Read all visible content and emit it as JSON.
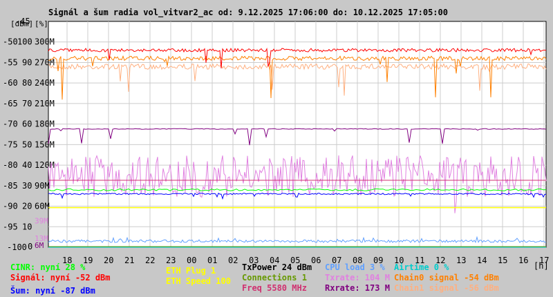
{
  "chart_data": {
    "type": "line",
    "title": "Signál a šum radia vol_vitvar2_ac od: 9.12.2025 17:06:00 do: 10.12.2025 17:05:00",
    "y_units": [
      "[dBm]",
      "[%]"
    ],
    "xlabel": "[h]",
    "x_ticks": [
      "18",
      "19",
      "20",
      "21",
      "22",
      "23",
      "00",
      "01",
      "02",
      "03",
      "04",
      "05",
      "06",
      "07",
      "08",
      "09",
      "10",
      "11",
      "12",
      "13",
      "14",
      "15",
      "16",
      "17"
    ],
    "y_ticks_dbm": [
      "-45",
      "-50",
      "-55",
      "-60",
      "-65",
      "-70",
      "-75",
      "-80",
      "-85",
      "-90",
      "-95",
      "-100"
    ],
    "y_ticks_pct": [
      "100",
      "90",
      "80",
      "70",
      "60",
      "50",
      "40",
      "30",
      "20",
      "10",
      "0"
    ],
    "y_ticks_rate": [
      "300M",
      "270M",
      "240M",
      "210M",
      "180M",
      "150M",
      "120M",
      "90M",
      "60M"
    ],
    "y_extra_labels": [
      {
        "text": "39M",
        "color": "#e080e0"
      },
      {
        "text": "13M",
        "color": "#e080e0"
      },
      {
        "text": "6M",
        "color": "#800080"
      }
    ],
    "ylim_dbm": [
      -100,
      -45
    ],
    "series": [
      {
        "name": "Signál",
        "value_dbm": -52,
        "color": "#ff0000"
      },
      {
        "name": "Chain0 signal",
        "value_dbm": -54,
        "color": "#ff8000"
      },
      {
        "name": "Chain1 signal",
        "value_dbm": -56,
        "color": "#ffb080"
      },
      {
        "name": "Rxrate",
        "value_m": 173,
        "color": "#800080"
      },
      {
        "name": "Txrate",
        "value_m": 104,
        "color": "#e080e0"
      },
      {
        "name": "Freq",
        "value_mhz": 5580,
        "color": "#d03070"
      },
      {
        "name": "CINR",
        "value_pct": 28,
        "color": "#00ff00"
      },
      {
        "name": "Šum",
        "value_dbm": -87,
        "color": "#0000ff"
      },
      {
        "name": "ETH Speed",
        "value": 100,
        "color": "#ffff00"
      },
      {
        "name": "CPU load",
        "value_pct": 3,
        "color": "#60a0ff"
      },
      {
        "name": "Connections",
        "value": 1,
        "color": "#669900"
      },
      {
        "name": "Airtime",
        "value_pct": 0,
        "color": "#00cccc"
      }
    ]
  },
  "legend": {
    "cinr": "CINR: nyní 28 %",
    "signal": "Signál: nyní -52 dBm",
    "noise": "Šum: nyní -87 dBm",
    "eth_plug": "ETH Plug 1",
    "eth_speed": "ETH Speed 100",
    "txpower": "TxPower 24 dBm",
    "connections": "Connections 1",
    "freq": "Freq 5580 MHz",
    "cpu": "CPU load 3 %",
    "txrate": "Txrate: 104 M",
    "rxrate": "Rxrate: 173 M",
    "airtime": "Airtime 0 %",
    "chain0": "Chain0 signal -54 dBm",
    "chain1": "Chain1 signal -56 dBm"
  }
}
